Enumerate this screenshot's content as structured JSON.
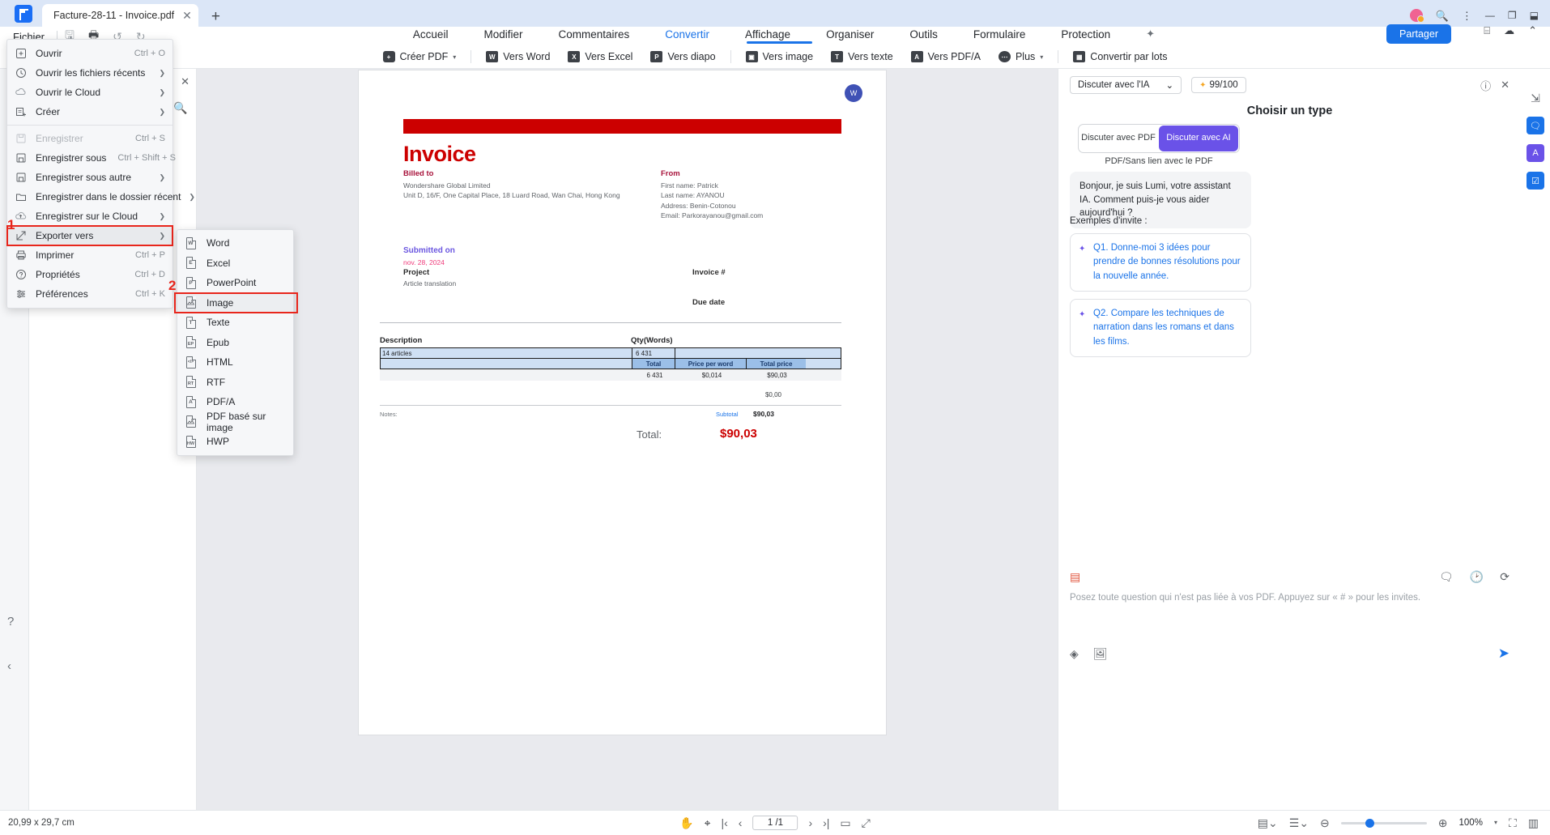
{
  "titlebar": {
    "logo_icon": "wondershare-pdfelement-logo",
    "tab_title": "Facture-28-11 - Invoice.pdf",
    "tab_close_icon": "close-icon",
    "new_tab_icon": "plus-icon",
    "avatar_icon": "user-avatar",
    "search_icon": "search-icon",
    "more_icon": "more-options-icon",
    "minimize_icon": "minimize-icon",
    "maximize_icon": "maximize-icon",
    "restore_icon": "restore-icon"
  },
  "menustrip": {
    "fichier": "Fichier",
    "save_icon": "save-icon",
    "print_icon": "print-icon",
    "undo_icon": "undo-icon",
    "redo_icon": "redo-icon"
  },
  "ribbon_tabs": [
    {
      "label": "Accueil",
      "active": false
    },
    {
      "label": "Modifier",
      "active": false
    },
    {
      "label": "Commentaires",
      "active": false
    },
    {
      "label": "Convertir",
      "active": true
    },
    {
      "label": "Affichage",
      "active": false
    },
    {
      "label": "Organiser",
      "active": false
    },
    {
      "label": "Outils",
      "active": false
    },
    {
      "label": "Formulaire",
      "active": false
    },
    {
      "label": "Protection",
      "active": false
    }
  ],
  "ribbon_right": {
    "ai_icon": "ai-sparkle-icon",
    "share_label": "Partager",
    "bookmark_icon": "bookmark-icon",
    "cloud_icon": "cloud-icon",
    "collapse_icon": "collapse-ribbon-icon"
  },
  "toolbar": [
    {
      "label": "Créer PDF",
      "icon": "create-pdf-icon",
      "caret": true
    },
    {
      "label": "Vers Word",
      "icon": "to-word-icon",
      "badge": "W"
    },
    {
      "label": "Vers Excel",
      "icon": "to-excel-icon",
      "badge": "X"
    },
    {
      "label": "Vers diapo",
      "icon": "to-slides-icon",
      "badge": "P"
    },
    {
      "label": "Vers image",
      "icon": "to-image-icon",
      "badge": "I",
      "selected": true
    },
    {
      "label": "Vers texte",
      "icon": "to-text-icon",
      "badge": "T"
    },
    {
      "label": "Vers PDF/A",
      "icon": "to-pdfa-icon",
      "badge": "A"
    },
    {
      "label": "Plus",
      "icon": "more-dots-icon",
      "caret": true
    },
    {
      "label": "Convertir par lots",
      "icon": "batch-convert-icon"
    }
  ],
  "left_rail": {
    "help_icon": "help-circle-icon",
    "collapse_icon": "chevron-left-icon"
  },
  "thumbnail_pane": {
    "close_icon": "close-icon",
    "search_icon": "search-icon"
  },
  "file_menu": {
    "items": [
      {
        "label": "Ouvrir",
        "accel": "Ctrl + O",
        "icon": "open-plus-icon",
        "arrow": false,
        "disabled": false
      },
      {
        "label": "Ouvrir les fichiers récents",
        "accel": "",
        "icon": "clock-icon",
        "arrow": true,
        "disabled": false
      },
      {
        "label": "Ouvrir le Cloud",
        "accel": "",
        "icon": "cloud-icon",
        "arrow": true,
        "disabled": false
      },
      {
        "label": "Créer",
        "accel": "",
        "icon": "create-doc-icon",
        "arrow": true,
        "disabled": false
      },
      {
        "separator": true
      },
      {
        "label": "Enregistrer",
        "accel": "Ctrl + S",
        "icon": "save-icon",
        "arrow": false,
        "disabled": true
      },
      {
        "label": "Enregistrer sous",
        "accel": "Ctrl + Shift + S",
        "icon": "save-as-icon",
        "arrow": false,
        "disabled": false
      },
      {
        "label": "Enregistrer sous autre",
        "accel": "",
        "icon": "save-other-icon",
        "arrow": true,
        "disabled": false
      },
      {
        "label": "Enregistrer dans le dossier récent",
        "accel": "",
        "icon": "folder-icon",
        "arrow": true,
        "disabled": false
      },
      {
        "label": "Enregistrer sur le Cloud",
        "accel": "",
        "icon": "cloud-upload-icon",
        "arrow": true,
        "disabled": false
      },
      {
        "label": "Exporter vers",
        "accel": "",
        "icon": "export-icon",
        "arrow": true,
        "disabled": false,
        "highlighted": true,
        "annotation": "1"
      },
      {
        "label": "Imprimer",
        "accel": "Ctrl + P",
        "icon": "print-icon",
        "arrow": false,
        "disabled": false
      },
      {
        "label": "Propriétés",
        "accel": "Ctrl + D",
        "icon": "properties-icon",
        "arrow": false,
        "disabled": false
      },
      {
        "label": "Préférences",
        "accel": "Ctrl + K",
        "icon": "preferences-icon",
        "arrow": false,
        "disabled": false
      }
    ]
  },
  "export_submenu": {
    "items": [
      {
        "label": "Word",
        "icon": "word-file-icon",
        "badge": "W"
      },
      {
        "label": "Excel",
        "icon": "excel-file-icon",
        "badge": "E"
      },
      {
        "label": "PowerPoint",
        "icon": "powerpoint-file-icon",
        "badge": "P"
      },
      {
        "label": "Image",
        "icon": "image-file-icon",
        "badge": "",
        "highlighted": true,
        "annotation": "2"
      },
      {
        "label": "Texte",
        "icon": "text-file-icon",
        "badge": "T"
      },
      {
        "label": "Epub",
        "icon": "epub-file-icon",
        "badge": "EP"
      },
      {
        "label": "HTML",
        "icon": "html-file-icon",
        "badge": "</>"
      },
      {
        "label": "RTF",
        "icon": "rtf-file-icon",
        "badge": "RT"
      },
      {
        "label": "PDF/A",
        "icon": "pdfa-file-icon",
        "badge": "A"
      },
      {
        "label": "PDF basé sur image",
        "icon": "image-pdf-file-icon",
        "badge": ""
      },
      {
        "label": "HWP",
        "icon": "hwp-file-icon",
        "badge": "HW"
      }
    ]
  },
  "document": {
    "watermark_badge": "W",
    "title": "Invoice",
    "billed_to": {
      "label": "Billed to",
      "lines": [
        "Wondershare Global Limited",
        "Unit D, 16/F, One Capital Place, 18 Luard Road, Wan Chai, Hong Kong"
      ]
    },
    "from": {
      "label": "From",
      "lines": [
        "First name: Patrick",
        "Last name: AYANOU",
        "Address: Benin-Cotonou",
        "Email: Parkorayanou@gmail.com"
      ]
    },
    "submitted_on_label": "Submitted on",
    "submitted_on_value": "nov. 28, 2024",
    "project_label": "Project",
    "project_value": "Article translation",
    "invoice_number_label": "Invoice #",
    "due_date_label": "Due date",
    "table": {
      "headers": [
        "Description",
        "Qty(Words)"
      ],
      "selected_row": {
        "description": "14 articles",
        "qty": "6 431"
      },
      "sub_headers": [
        "Total",
        "Price per word",
        "Total price"
      ],
      "sub_values": [
        "6 431",
        "$0,014",
        "$90,03"
      ]
    },
    "zero_value": "$0,00",
    "notes_label": "Notes:",
    "subtotal_label": "Subtotal",
    "subtotal_value": "$90,03",
    "total_label": "Total:",
    "total_value": "$90,03"
  },
  "ai_panel": {
    "mode_select": "Discuter avec l'IA",
    "credits": "99/100",
    "credit_star_icon": "sparkle-icon",
    "help_icon": "help-circle-icon",
    "close_icon": "close-icon",
    "heading": "Choisir un type",
    "segment_options": [
      {
        "label": "Discuter avec PDF",
        "selected": false
      },
      {
        "label": "Discuter avec AI",
        "selected": true
      }
    ],
    "segment_note": "PDF/Sans lien avec le PDF",
    "greeting": "Bonjour, je suis Lumi, votre assistant IA. Comment puis-je vous aider aujourd'hui ?",
    "examples_title": "Exemples d'invite :",
    "prompts": [
      "Q1. Donne-moi 3 idées pour prendre de bonnes résolutions pour la nouvelle année.",
      "Q2. Compare les techniques de narration dans les romans et dans les films."
    ],
    "footer_icons": [
      "book-red-icon",
      "chat-icon",
      "history-icon",
      "refresh-icon"
    ],
    "input_placeholder": "Posez toute question qui n'est pas liée à vos PDF. Appuyez sur « # » pour les invites.",
    "bottom_icons": [
      "location-icon",
      "image-icon"
    ],
    "send_icon": "send-icon"
  },
  "edge_rail": {
    "icons": [
      "chat-bubble-icon",
      "ai-assistant-icon",
      "checklist-icon"
    ]
  },
  "statusbar": {
    "dimensions": "20,99 x 29,7 cm",
    "hand_icon": "hand-tool-icon",
    "select_icon": "select-tool-icon",
    "first_page_icon": "first-page-icon",
    "prev_page_icon": "prev-page-icon",
    "page_value": "1 /1",
    "next_page_icon": "next-page-icon",
    "last_page_icon": "last-page-icon",
    "single_page_icon": "single-page-view-icon",
    "fit_width_icon": "fit-width-icon",
    "layout_icon": "page-layout-icon",
    "scroll_icon": "scroll-mode-icon",
    "zoom_out_icon": "zoom-out-icon",
    "zoom_in_icon": "zoom-in-icon",
    "zoom_value": "100%",
    "zoom_caret_icon": "chevron-down-icon",
    "fullscreen_icon": "fullscreen-icon",
    "split_icon": "split-view-icon"
  },
  "colors": {
    "accent": "#1a73e8",
    "invoice_red": "#cc0000",
    "annotation_red": "#e8261c",
    "ai_purple": "#6a52e8",
    "titlebar": "#dbe6f7"
  }
}
